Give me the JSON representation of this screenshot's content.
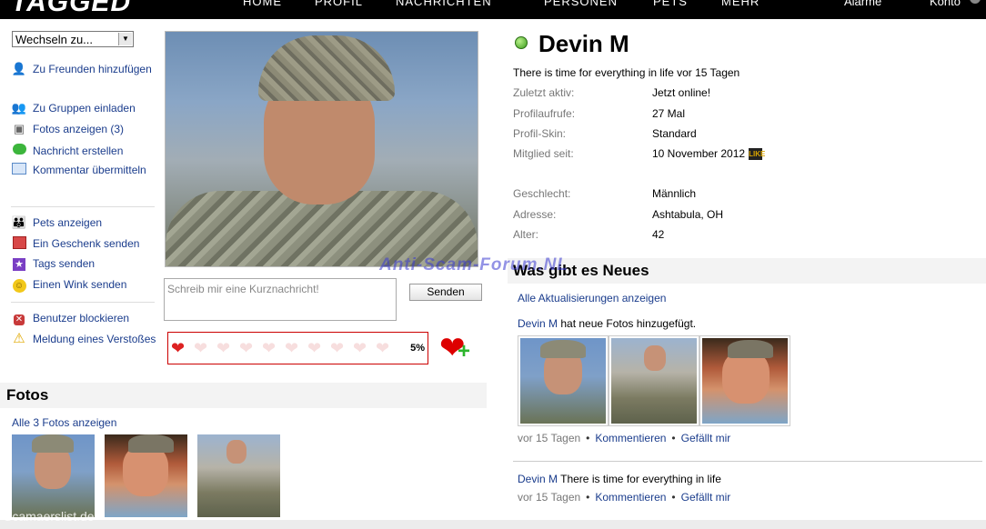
{
  "nav": {
    "logo": "TAGGED",
    "items": [
      "HOME",
      "PROFIL",
      "NACHRICHTEN",
      "PERSONEN",
      "PETS",
      "MEHR"
    ],
    "right": [
      "Alarme",
      "Konto"
    ]
  },
  "switcher": {
    "label": "Wechseln zu..."
  },
  "actions": {
    "add_friend": "Zu Freunden hinzufügen",
    "invite_groups": "Zu Gruppen einladen",
    "show_photos": "Fotos anzeigen (3)",
    "create_message": "Nachricht erstellen",
    "submit_comment": "Kommentar übermitteln",
    "show_pets": "Pets anzeigen",
    "send_gift": "Ein Geschenk senden",
    "send_tags": "Tags senden",
    "send_wink": "Einen Wink senden",
    "block_user": "Benutzer blockieren",
    "report_violation": "Meldung eines Verstoßes"
  },
  "shoutbox": {
    "placeholder": "Schreib mir eine Kurznachricht!",
    "send": "Senden"
  },
  "meter": {
    "percent_label": "5%",
    "level": 0.05
  },
  "photos": {
    "title": "Fotos",
    "show_all": "Alle 3 Fotos anzeigen"
  },
  "profile": {
    "name": "Devin M",
    "status": "There is time for everything in life vor 15 Tagen",
    "fields": [
      {
        "label": "Zuletzt aktiv:",
        "value": "Jetzt online!"
      },
      {
        "label": "Profilaufrufe:",
        "value": "27 Mal"
      },
      {
        "label": "Profil-Skin:",
        "value": "Standard"
      },
      {
        "label": "Mitglied seit:",
        "value": "10 November 2012"
      },
      {
        "label": "Geschlecht:",
        "value": "Männlich"
      },
      {
        "label": "Adresse:",
        "value": "Ashtabula, OH"
      },
      {
        "label": "Alter:",
        "value": "42"
      }
    ],
    "member_badge": "LIKE"
  },
  "news": {
    "title": "Was gibt es Neues",
    "show_all": "Alle Aktualisierungen anzeigen",
    "item1": {
      "author": "Devin M",
      "text": " hat neue Fotos hinzugefügt.",
      "time": "vor 15 Tagen",
      "comment": "Kommentieren",
      "like": "Gefällt mir"
    },
    "item2": {
      "author": "Devin M",
      "text": " There is time for everything in life",
      "time": "vor 15 Tagen",
      "comment": "Kommentieren",
      "like": "Gefällt mir"
    }
  },
  "watermarks": {
    "center": "Anti-Scam-Forum.NL",
    "bottom": "Scamaerslist.de"
  }
}
